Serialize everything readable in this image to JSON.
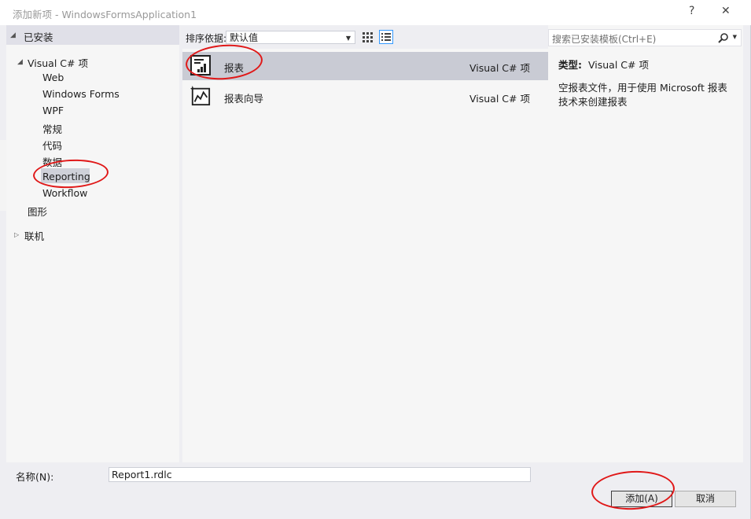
{
  "window": {
    "title": "添加新项 - WindowsFormsApplication1",
    "help_glyph": "?",
    "close_glyph": "✕"
  },
  "tree": {
    "installed_label": "已安装",
    "root_label": "Visual C# 项",
    "children": [
      "Web",
      "Windows Forms",
      "WPF",
      "常规",
      "代码",
      "数据",
      "Reporting",
      "Workflow"
    ],
    "graphics_label": "图形",
    "online_label": "联机",
    "selected": "Reporting"
  },
  "sort": {
    "label": "排序依据:",
    "value": "默认值"
  },
  "templates": [
    {
      "name": "报表",
      "type": "Visual C# 项",
      "icon": "report-icon",
      "selected": true
    },
    {
      "name": "报表向导",
      "type": "Visual C# 项",
      "icon": "report-wizard-icon",
      "selected": false
    }
  ],
  "search": {
    "placeholder": "搜索已安装模板(Ctrl+E)",
    "icon": "search-icon"
  },
  "details": {
    "type_label": "类型:",
    "type_value": "Visual C# 项",
    "description": "空报表文件，用于使用 Microsoft 报表技术来创建报表"
  },
  "name_field": {
    "label": "名称(N):",
    "value": "Report1.rdlc"
  },
  "buttons": {
    "add": "添加(A)",
    "cancel": "取消"
  },
  "colors": {
    "selection": "#c9cbd4",
    "annotation": "#e01818"
  }
}
